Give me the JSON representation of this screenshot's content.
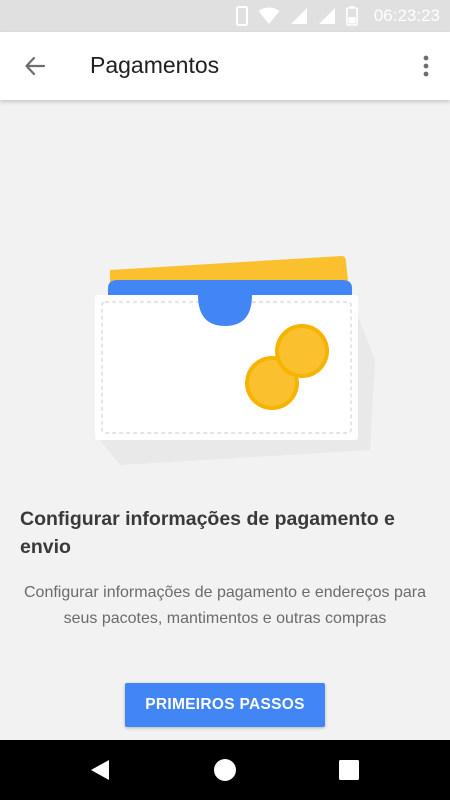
{
  "status_bar": {
    "time": "06:23:23",
    "icons": [
      "phone-outline-icon",
      "wifi-icon",
      "signal-icon",
      "signal-icon",
      "battery-icon"
    ]
  },
  "app_bar": {
    "title": "Pagamentos",
    "back_icon": "arrow-back-icon",
    "menu_icon": "more-vert-icon"
  },
  "content": {
    "illustration": "wallet-with-coins",
    "headline": "Configurar informações de pagamento e envio",
    "description": "Configurar informações de pagamento e endereços para seus pacotes, mantimentos e outras compras",
    "primary_button_label": "PRIMEIROS PASSOS"
  },
  "navigation_bar": {
    "buttons": [
      "back-triangle-icon",
      "home-circle-icon",
      "recents-square-icon"
    ]
  },
  "colors": {
    "accent": "#4285f4",
    "wallet_yellow": "#fbc02d",
    "wallet_blue": "#4285f4",
    "coin": "#fbc02d",
    "status_bar": "#e0e0e0",
    "background": "#f2f2f2"
  }
}
